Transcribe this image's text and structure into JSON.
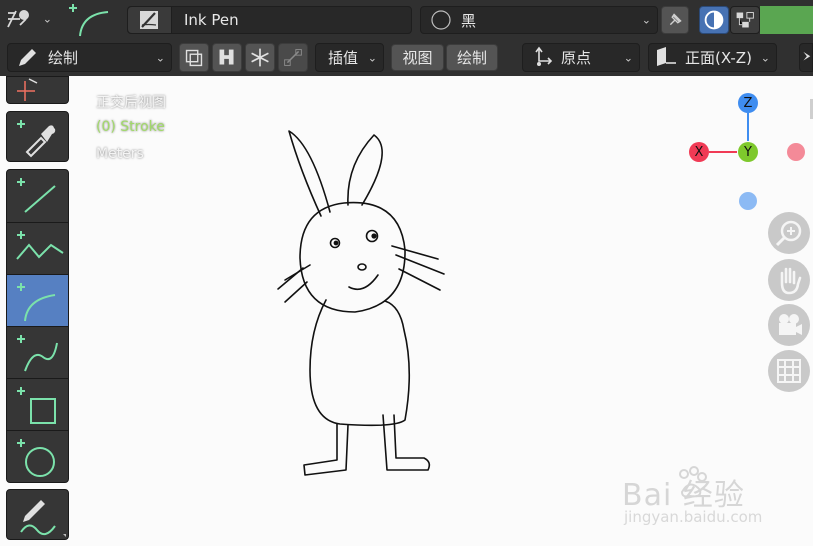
{
  "header": {
    "brush_name": "Ink Pen",
    "material_name": "黑"
  },
  "toolbar": {
    "mode_label": "绘制",
    "interp_label": "插值",
    "view_label": "视图",
    "draw_label": "绘制",
    "origin_label": "原点",
    "plane_label": "正面(X-Z)"
  },
  "viewport": {
    "view_name": "正交后视图",
    "object_info": "(0) Stroke",
    "units": "Meters"
  },
  "gizmo": {
    "z": "Z",
    "x": "X",
    "y": "Y"
  },
  "watermark": {
    "brand": "Bai  经验",
    "url": "jingyan.baidu.com"
  },
  "colors": {
    "header_bg": "#303030",
    "viewport_bg": "#fbfbfb",
    "active_tool": "#5680c2",
    "tool_accent": "#79dfa9",
    "axis_x": "#f03a55",
    "axis_y": "#7ec82c",
    "axis_z": "#3f8df0",
    "object_info": "#a2d96b"
  },
  "icons": {
    "editor_type": "grease-pencil-editor-icon",
    "tool_preview": "arc-tool-icon",
    "brush": "brush-icon",
    "material": "material-sphere-icon",
    "pin": "pin-icon",
    "overlay": "overlay-icon",
    "gizmo": "gizmo-icon",
    "mode": "pencil-icon",
    "origin": "origin-icon",
    "plane": "plane-icon"
  }
}
